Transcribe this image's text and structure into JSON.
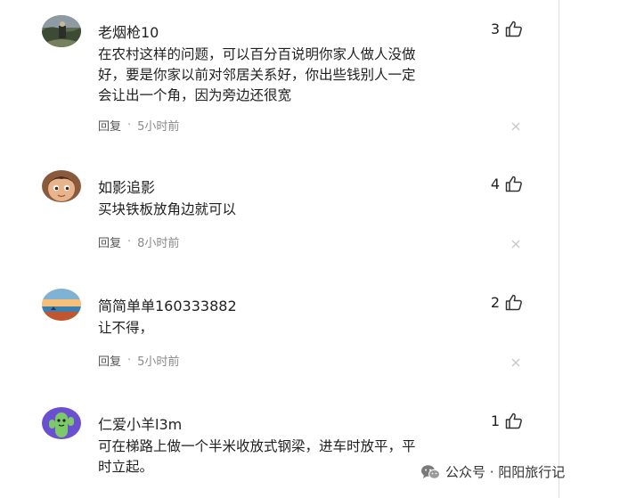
{
  "comments": [
    {
      "username": "老烟枪10",
      "likes": "3",
      "text_lines": [
        "在农村这样的问题，可以百分百说明你家人做人没做",
        "好，要是你家以前对邻居关系好，你出些钱别人一定",
        "会让出一个角，因为旁边还很宽"
      ],
      "reply_label": "回复",
      "separator": "·",
      "time": "5小时前",
      "avatar_icon": "avatar-scenic-photo-icon"
    },
    {
      "username": "如影追影",
      "likes": "4",
      "text_lines": [
        "买块铁板放角边就可以"
      ],
      "reply_label": "回复",
      "separator": "·",
      "time": "8小时前",
      "avatar_icon": "avatar-cartoon-character-icon"
    },
    {
      "username": "简简单单160333882",
      "likes": "2",
      "text_lines": [
        "让不得，"
      ],
      "reply_label": "回复",
      "separator": "·",
      "time": "5小时前",
      "avatar_icon": "avatar-sunset-lake-icon"
    },
    {
      "username": "仁爱小羊l3m",
      "likes": "1",
      "text_lines": [
        "可在梯路上做一个半米收放式钢梁，进车时放平，平",
        "时立起。"
      ],
      "avatar_icon": "avatar-cactus-cartoon-icon"
    }
  ],
  "watermark": {
    "text": "公众号 · 阳阳旅行记",
    "icon": "wechat-icon"
  },
  "colors": {
    "text": "#222222",
    "meta": "#8a8a8a",
    "icon_stroke": "#333333",
    "close": "#c8c8c8"
  }
}
